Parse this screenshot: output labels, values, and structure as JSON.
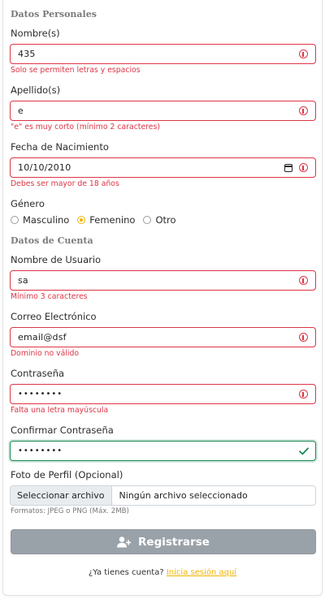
{
  "sections": {
    "personal": "Datos Personales",
    "account": "Datos de Cuenta"
  },
  "nombre": {
    "label": "Nombre(s)",
    "value": "435",
    "error": "Solo se permiten letras y espacios"
  },
  "apellido": {
    "label": "Apellido(s)",
    "value": "e",
    "error": "\"e\" es muy corto (mínimo 2 caracteres)"
  },
  "fecha": {
    "label": "Fecha de Nacimiento",
    "value": "10/10/2010",
    "error": "Debes ser mayor de 18 años"
  },
  "genero": {
    "label": "Género",
    "options": [
      "Masculino",
      "Femenino",
      "Otro"
    ],
    "selected": "Femenino"
  },
  "usuario": {
    "label": "Nombre de Usuario",
    "value": "sa",
    "error": "Mínimo 3 caracteres"
  },
  "correo": {
    "label": "Correo Electrónico",
    "value": "email@dsf",
    "error": "Dominio no válido"
  },
  "password": {
    "label": "Contraseña",
    "value": "••••••••",
    "error": "Falta una letra mayúscula"
  },
  "confirm": {
    "label": "Confirmar Contraseña",
    "value": "••••••••"
  },
  "foto": {
    "label": "Foto de Perfil (Opcional)",
    "button": "Seleccionar archivo",
    "filename": "Ningún archivo seleccionado",
    "hint": "Formatos: JPEG o PNG (Máx. 2MB)"
  },
  "submit_label": "Registrarse",
  "login": {
    "question": "¿Ya tienes cuenta?",
    "link": "Inicia sesión aquí"
  },
  "colors": {
    "error": "#dc3545",
    "valid": "#198754",
    "accent": "#f0b400",
    "button": "#9aa2a9"
  },
  "icons": {
    "error": "error-circle-icon",
    "calendar": "calendar-icon",
    "check": "check-icon",
    "user_add": "user-plus-icon"
  }
}
